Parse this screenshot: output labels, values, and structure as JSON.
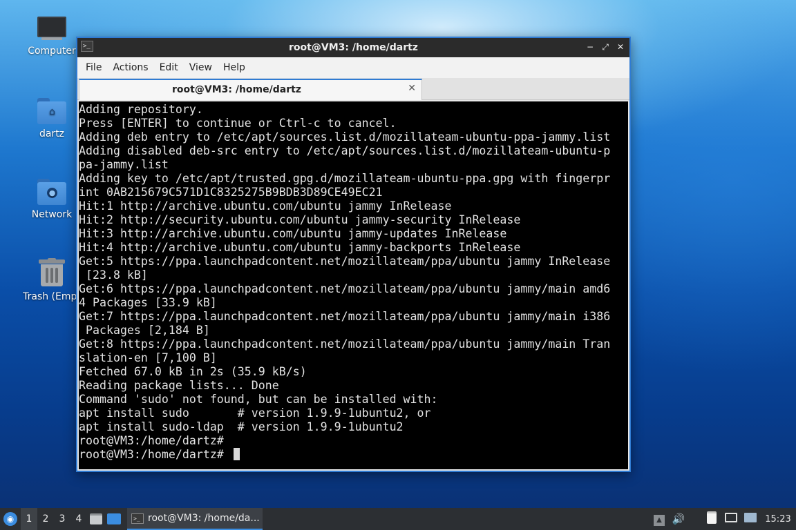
{
  "desktop": {
    "icons": [
      {
        "label": "Computer",
        "icon": "computer-icon"
      },
      {
        "label": "dartz",
        "icon": "home-folder-icon"
      },
      {
        "label": "Network",
        "icon": "network-folder-icon"
      },
      {
        "label": "Trash (Empt",
        "icon": "trash-icon"
      }
    ]
  },
  "window": {
    "title": "root@VM3: /home/dartz",
    "controls": {
      "minimize": "−",
      "maximize": "⤢",
      "close": "✕"
    },
    "menu": [
      "File",
      "Actions",
      "Edit",
      "View",
      "Help"
    ],
    "tab": {
      "label": "root@VM3: /home/dartz",
      "close": "✕"
    },
    "terminal_lines": [
      "Adding repository.",
      "Press [ENTER] to continue or Ctrl-c to cancel.",
      "Adding deb entry to /etc/apt/sources.list.d/mozillateam-ubuntu-ppa-jammy.list",
      "Adding disabled deb-src entry to /etc/apt/sources.list.d/mozillateam-ubuntu-p",
      "pa-jammy.list",
      "Adding key to /etc/apt/trusted.gpg.d/mozillateam-ubuntu-ppa.gpg with fingerpr",
      "int 0AB215679C571D1C8325275B9BDB3D89CE49EC21",
      "Hit:1 http://archive.ubuntu.com/ubuntu jammy InRelease",
      "Hit:2 http://security.ubuntu.com/ubuntu jammy-security InRelease",
      "Hit:3 http://archive.ubuntu.com/ubuntu jammy-updates InRelease",
      "Hit:4 http://archive.ubuntu.com/ubuntu jammy-backports InRelease",
      "Get:5 https://ppa.launchpadcontent.net/mozillateam/ppa/ubuntu jammy InRelease",
      " [23.8 kB]",
      "Get:6 https://ppa.launchpadcontent.net/mozillateam/ppa/ubuntu jammy/main amd6",
      "4 Packages [33.9 kB]",
      "Get:7 https://ppa.launchpadcontent.net/mozillateam/ppa/ubuntu jammy/main i386",
      " Packages [2,184 B]",
      "Get:8 https://ppa.launchpadcontent.net/mozillateam/ppa/ubuntu jammy/main Tran",
      "slation-en [7,100 B]",
      "Fetched 67.0 kB in 2s (35.9 kB/s)",
      "Reading package lists... Done",
      "Command 'sudo' not found, but can be installed with:",
      "apt install sudo       # version 1.9.9-1ubuntu2, or",
      "apt install sudo-ldap  # version 1.9.9-1ubuntu2",
      "root@VM3:/home/dartz#"
    ],
    "prompt": "root@VM3:/home/dartz# "
  },
  "taskbar": {
    "workspaces": [
      "1",
      "2",
      "3",
      "4"
    ],
    "active_workspace": "1",
    "task_label": "root@VM3: /home/da...",
    "clock": "15:23",
    "accent": "#3b8de0"
  }
}
